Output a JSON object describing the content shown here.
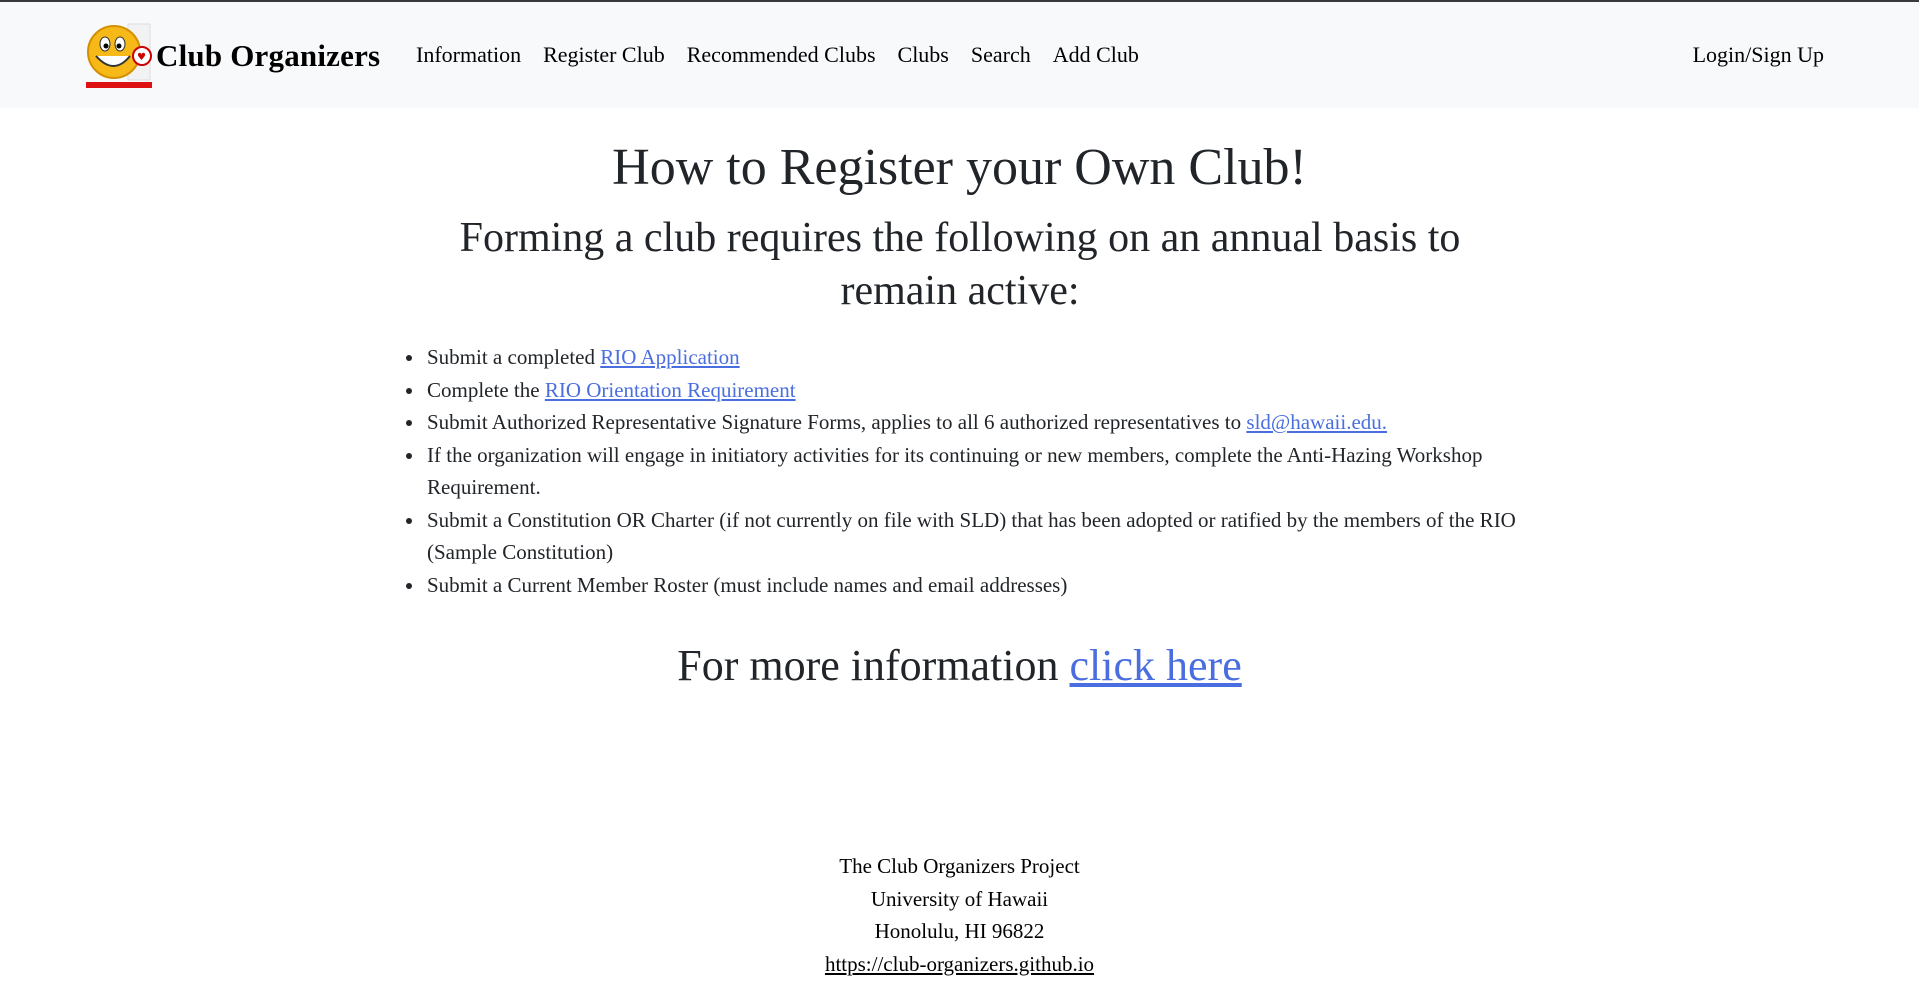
{
  "navbar": {
    "brand": "Club Organizers",
    "logo_icon": "smiley-face-logo-icon",
    "links": [
      "Information",
      "Register Club",
      "Recommended Clubs",
      "Clubs",
      "Search",
      "Add Club"
    ],
    "login": "Login/Sign Up"
  },
  "main": {
    "title": "How to Register your Own Club!",
    "subtitle": "Forming a club requires the following on an annual basis to remain active:",
    "items": [
      {
        "pre": "Submit a completed ",
        "link": "RIO Application",
        "post": ""
      },
      {
        "pre": "Complete the ",
        "link": "RIO Orientation Requirement",
        "post": ""
      },
      {
        "pre": "Submit Authorized Representative Signature Forms, applies to all 6 authorized representatives to ",
        "link": "sld@hawaii.edu.",
        "post": ""
      },
      {
        "pre": "If the organization will engage in initiatory activities for its continuing or new members, complete the Anti-Hazing Workshop Requirement.",
        "link": "",
        "post": ""
      },
      {
        "pre": "Submit a Constitution OR Charter (if not currently on file with SLD) that has been adopted or ratified by the members of the RIO (Sample Constitution)",
        "link": "",
        "post": ""
      },
      {
        "pre": "Submit a Current Member Roster (must include names and email addresses)",
        "link": "",
        "post": ""
      }
    ],
    "more_text": "For more information ",
    "more_link": "click here"
  },
  "footer": {
    "line1": "The Club Organizers Project",
    "line2": "University of Hawaii",
    "line3": "Honolulu, HI 96822",
    "url": "https://club-organizers.github.io"
  },
  "colors": {
    "link": "#4a6ee0",
    "navbar_bg": "#f8f9fa"
  }
}
